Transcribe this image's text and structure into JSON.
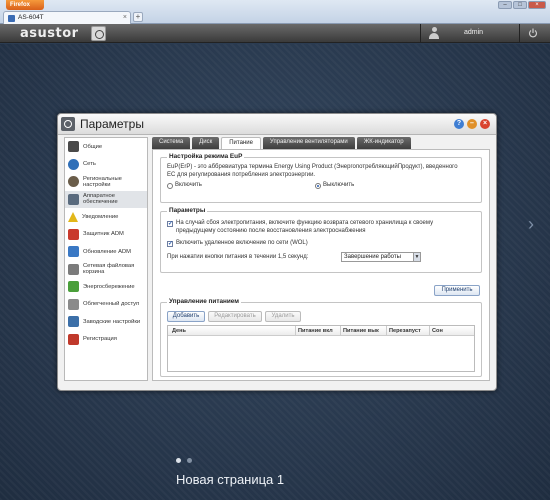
{
  "browser": {
    "menu_button": "Firefox",
    "tab_title": "AS-604T",
    "tab_close": "×",
    "new_tab": "+",
    "window_buttons": [
      "–",
      "□",
      "×"
    ]
  },
  "adm_bar": {
    "logo": "asustor",
    "username": "admin"
  },
  "desktop": {
    "page_name": "Новая страница 1",
    "next_arrow": "›",
    "page_dots_active": 0
  },
  "window": {
    "title": "Параметры",
    "help_btn": "?",
    "min_btn": "–",
    "close_btn": "×",
    "sidebar": [
      {
        "label": "Общие",
        "icon": "general-icon",
        "color": "#4a4a4a"
      },
      {
        "label": "Сеть",
        "icon": "globe-icon",
        "color": "#2f6fb8"
      },
      {
        "label": "Региональные настройки",
        "icon": "clock-icon",
        "color": "#6a5d4a"
      },
      {
        "label": "Аппаратное обеспечение",
        "icon": "hardware-icon",
        "color": "#5a6b7e"
      },
      {
        "label": "Уведомление",
        "icon": "warning-icon",
        "color": "#e2b719"
      },
      {
        "label": "Защитник ADM",
        "icon": "shield-icon",
        "color": "#c9392c"
      },
      {
        "label": "Обновление ADM",
        "icon": "upload-icon",
        "color": "#3a78c4"
      },
      {
        "label": "Сетевая файловая корзина",
        "icon": "trash-icon",
        "color": "#7b7b7b"
      },
      {
        "label": "Энергосбережение",
        "icon": "leaf-icon",
        "color": "#4a9f3a"
      },
      {
        "label": "Облегченный доступ",
        "icon": "key-icon",
        "color": "#8a8a8a"
      },
      {
        "label": "Заводские настройки",
        "icon": "reset-icon",
        "color": "#3c6fa8"
      },
      {
        "label": "Регистрация",
        "icon": "registration-icon",
        "color": "#c0392b"
      }
    ],
    "active_sidebar_index": 3,
    "tabs": [
      "Система",
      "Диск",
      "Питание",
      "Управление вентиляторами",
      "ЖК-индикатор"
    ],
    "active_tab_index": 2,
    "eup": {
      "title": "Настройка режима EuP",
      "description": "EuP(ErP) - это аббревиатура термина Energy Using Product (ЭнергопотребляющийПродукт), введенного ЕС для регулирования потребления электроэнергии.",
      "enable_label": "Включить",
      "disable_label": "Выключить",
      "selected": "disable"
    },
    "params": {
      "title": "Параметры",
      "power_restore_label": "На случай сбоя электропитания, включите функцию возврата сетевого хранилища к своему предыдущему состоянию после восстановления электроснабжения",
      "power_restore_checked": true,
      "wol_label": "Включить удаленное включение по сети (WOL)",
      "wol_checked": true,
      "power_button_label": "При нажатии кнопки питания в течении 1,5 секунд:",
      "power_button_value": "Завершение работы"
    },
    "apply_button": "Применить",
    "schedule": {
      "title": "Управление питанием",
      "add_button": "Добавить",
      "edit_button": "Редактировать",
      "delete_button": "Удалить",
      "columns": [
        "День",
        "Питание вкл",
        "Питание вык",
        "Перезапуст",
        "Сон"
      ],
      "rows": []
    }
  }
}
